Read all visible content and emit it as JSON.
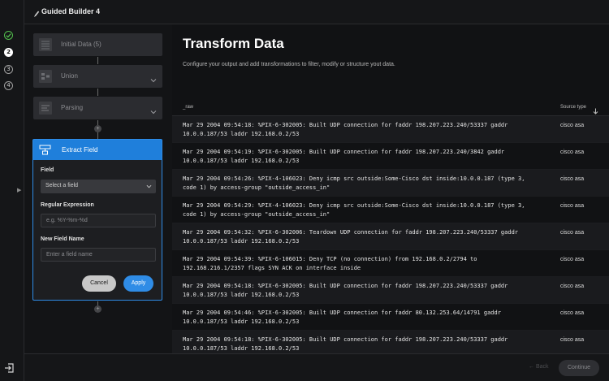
{
  "app": {
    "title": "Guided Builder 4"
  },
  "steps": [
    "1",
    "2",
    "3",
    "4"
  ],
  "pipeline": {
    "nodes": [
      {
        "label": "Initial Data (5)",
        "icon": "table-icon"
      },
      {
        "label": "Union",
        "icon": "union-icon"
      },
      {
        "label": "Parsing",
        "icon": "parsing-icon"
      }
    ],
    "panel": {
      "title": "Extract Field",
      "field_label": "Field",
      "field_select": "Select a field",
      "regex_label": "Regular Expression",
      "regex_placeholder": "e.g. %Y-%m-%d",
      "newname_label": "New Field Name",
      "newname_placeholder": "Enter a field name",
      "cancel_label": "Cancel",
      "apply_label": "Apply"
    }
  },
  "main": {
    "title": "Transform Data",
    "subtitle": "Configure your output and add transformations to filter, modify or structure yout data.",
    "columns": {
      "raw": "_raw",
      "source": "Source type"
    },
    "rows": [
      {
        "raw": "Mar 29 2004 09:54:18: %PIX-6-302005: Built UDP connection for faddr 198.207.223.240/53337 gaddr 10.0.0.187/53 laddr 192.168.0.2/53",
        "source": "cisco asa"
      },
      {
        "raw": "Mar 29 2004 09:54:19: %PIX-6-302005: Built UDP connection for faddr 198.207.223.240/3842 gaddr 10.0.0.187/53 laddr 192.168.0.2/53",
        "source": "cisco asa"
      },
      {
        "raw": "Mar 29 2004 09:54:26: %PIX-4-106023: Deny icmp src outside:Some-Cisco dst inside:10.0.0.187 (type 3, code 1) by access-group \"outside_access_in\"",
        "source": "cisco asa"
      },
      {
        "raw": "Mar 29 2004 09:54:29: %PIX-4-106023: Deny icmp src outside:Some-Cisco dst inside:10.0.0.187 (type 3, code 1) by access-group \"outside_access_in\"",
        "source": "cisco asa"
      },
      {
        "raw": "Mar 29 2004 09:54:32: %PIX-6-302006: Teardown UDP connection for faddr 198.207.223.240/53337 gaddr 10.0.0.187/53 laddr 192.168.0.2/53",
        "source": "cisco asa"
      },
      {
        "raw": "Mar 29 2004 09:54:39: %PIX-6-106015: Deny TCP (no connection) from 192.168.0.2/2794 to 192.168.216.1/2357 flags SYN ACK on interface inside",
        "source": "cisco asa"
      },
      {
        "raw": "Mar 29 2004 09:54:18: %PIX-6-302005: Built UDP connection for faddr 198.207.223.240/53337 gaddr 10.0.0.187/53 laddr 192.168.0.2/53",
        "source": "cisco asa"
      },
      {
        "raw": "Mar 29 2004 09:54:46: %PIX-6-302005: Built UDP connection for faddr 80.132.253.64/14791 gaddr 10.0.0.187/53 laddr 192.168.0.2/53",
        "source": "cisco asa"
      },
      {
        "raw": "Mar 29 2004 09:54:18: %PIX-6-302005: Built UDP connection for faddr 198.207.223.240/53337 gaddr 10.0.0.187/53 laddr 192.168.0.2/53",
        "source": "cisco asa"
      }
    ]
  },
  "footer": {
    "back_label": "Back",
    "continue_label": "Continue"
  },
  "colors": {
    "accent": "#2f8ce6",
    "success": "#53c04d",
    "background": "#111214"
  }
}
